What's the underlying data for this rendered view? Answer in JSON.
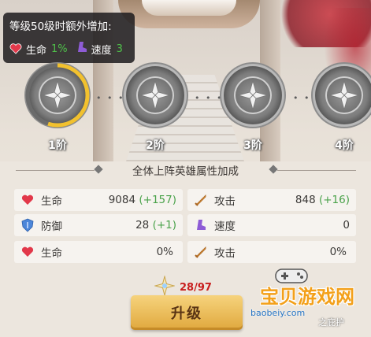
{
  "tooltip": {
    "title": "等级50级时额外增加:",
    "hp_label": "生命",
    "hp_value": "1%",
    "speed_label": "速度",
    "speed_value": "3"
  },
  "stages": [
    {
      "label": "1阶",
      "progress": 0.55
    },
    {
      "label": "2阶",
      "progress": 0
    },
    {
      "label": "3阶",
      "progress": 0
    },
    {
      "label": "4阶",
      "progress": 0
    }
  ],
  "section_title": "全体上阵英雄属性加成",
  "stats": {
    "hp_label": "生命",
    "hp_value": "9084",
    "hp_bonus": "(+157)",
    "attack_label": "攻击",
    "attack_value": "848",
    "attack_bonus": "(+16)",
    "defense_label": "防御",
    "defense_value": "28",
    "defense_bonus": "(+1)",
    "speed_label": "速度",
    "speed_value": "0",
    "hp_pct_label": "生命",
    "hp_pct_value": "0%",
    "attack_pct_label": "攻击",
    "attack_pct_value": "0%"
  },
  "points": {
    "count": "28/97"
  },
  "upgrade_label": "升级",
  "watermark": {
    "text": "宝贝游戏网",
    "url": "baobeiy.com",
    "sub": "之庇护"
  },
  "colors": {
    "bonus_green": "#4aa24a",
    "count_red": "#c81e1e",
    "button_gold": "#e0a83d"
  }
}
